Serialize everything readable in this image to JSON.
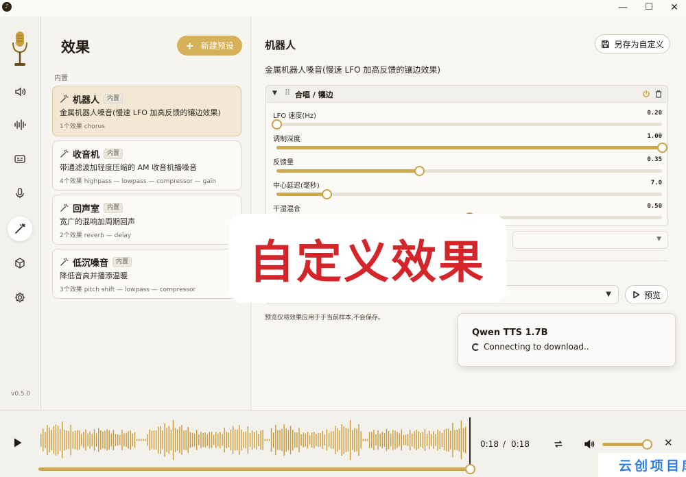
{
  "window": {
    "minimize": "—",
    "maximize": "☐",
    "close": "✕"
  },
  "rail": {
    "version": "v0.5.0",
    "items": [
      "speaker-icon",
      "waveform-icon",
      "caption-icon",
      "mic-icon",
      "magic-wand-icon",
      "cube-icon",
      "gear-icon"
    ],
    "active": "magic-wand-icon"
  },
  "list": {
    "title": "效果",
    "new_button": "新建预设",
    "section": "内置",
    "effects": [
      {
        "name": "机器人",
        "badge": "内置",
        "desc": "金属机器人嗓音(慢速 LFO 加高反馈的镶边效果)",
        "meta": "1个效果 chorus"
      },
      {
        "name": "收音机",
        "badge": "内置",
        "desc": "带通滤波加轻度压缩的 AM 收音机播噪音",
        "meta": "4个效果 highpass — lowpass — compressor — gain"
      },
      {
        "name": "回声室",
        "badge": "内置",
        "desc": "宽广的混响加周期回声",
        "meta": "2个效果 reverb — delay"
      },
      {
        "name": "低沉嗓音",
        "badge": "内置",
        "desc": "降低音高并播添温暖",
        "meta": "3个效果 pitch shift — lowpass — compressor"
      }
    ]
  },
  "detail": {
    "title": "机器人",
    "save_button": "另存为自定义",
    "desc": "金属机器人嗓音(慢速 LFO 加高反馈的镶边效果)",
    "chain": {
      "name": "合唱 / 镶边",
      "params": [
        {
          "label": "LFO 速度(Hz)",
          "value": "0.20",
          "fraction": 0.0
        },
        {
          "label": "调制深度",
          "value": "1.00",
          "fraction": 1.0
        },
        {
          "label": "反馈量",
          "value": "0.35",
          "fraction": 0.37
        },
        {
          "label": "中心延迟(毫秒)",
          "value": "7.0",
          "fraction": 0.13
        },
        {
          "label": "干湿混合",
          "value": "0.50",
          "fraction": 0.5
        }
      ]
    },
    "preview_button": "预览",
    "preview_note": "预览仅将效果应用于于当前样本,不会保存。"
  },
  "overlay": {
    "text": "自定义效果"
  },
  "toast": {
    "title": "Qwen TTS 1.7B",
    "message": "Connecting to download.."
  },
  "player": {
    "current": "0:18",
    "separator": "/",
    "duration": "0:18",
    "progress": 1.0,
    "volume": 1.0
  },
  "watermark": {
    "text": "云创项目库"
  },
  "colors": {
    "accent": "#cfa94f",
    "overlay_text": "#d4262a",
    "selected_card": "#f2e8d4",
    "watermark": "#2d7be0"
  }
}
